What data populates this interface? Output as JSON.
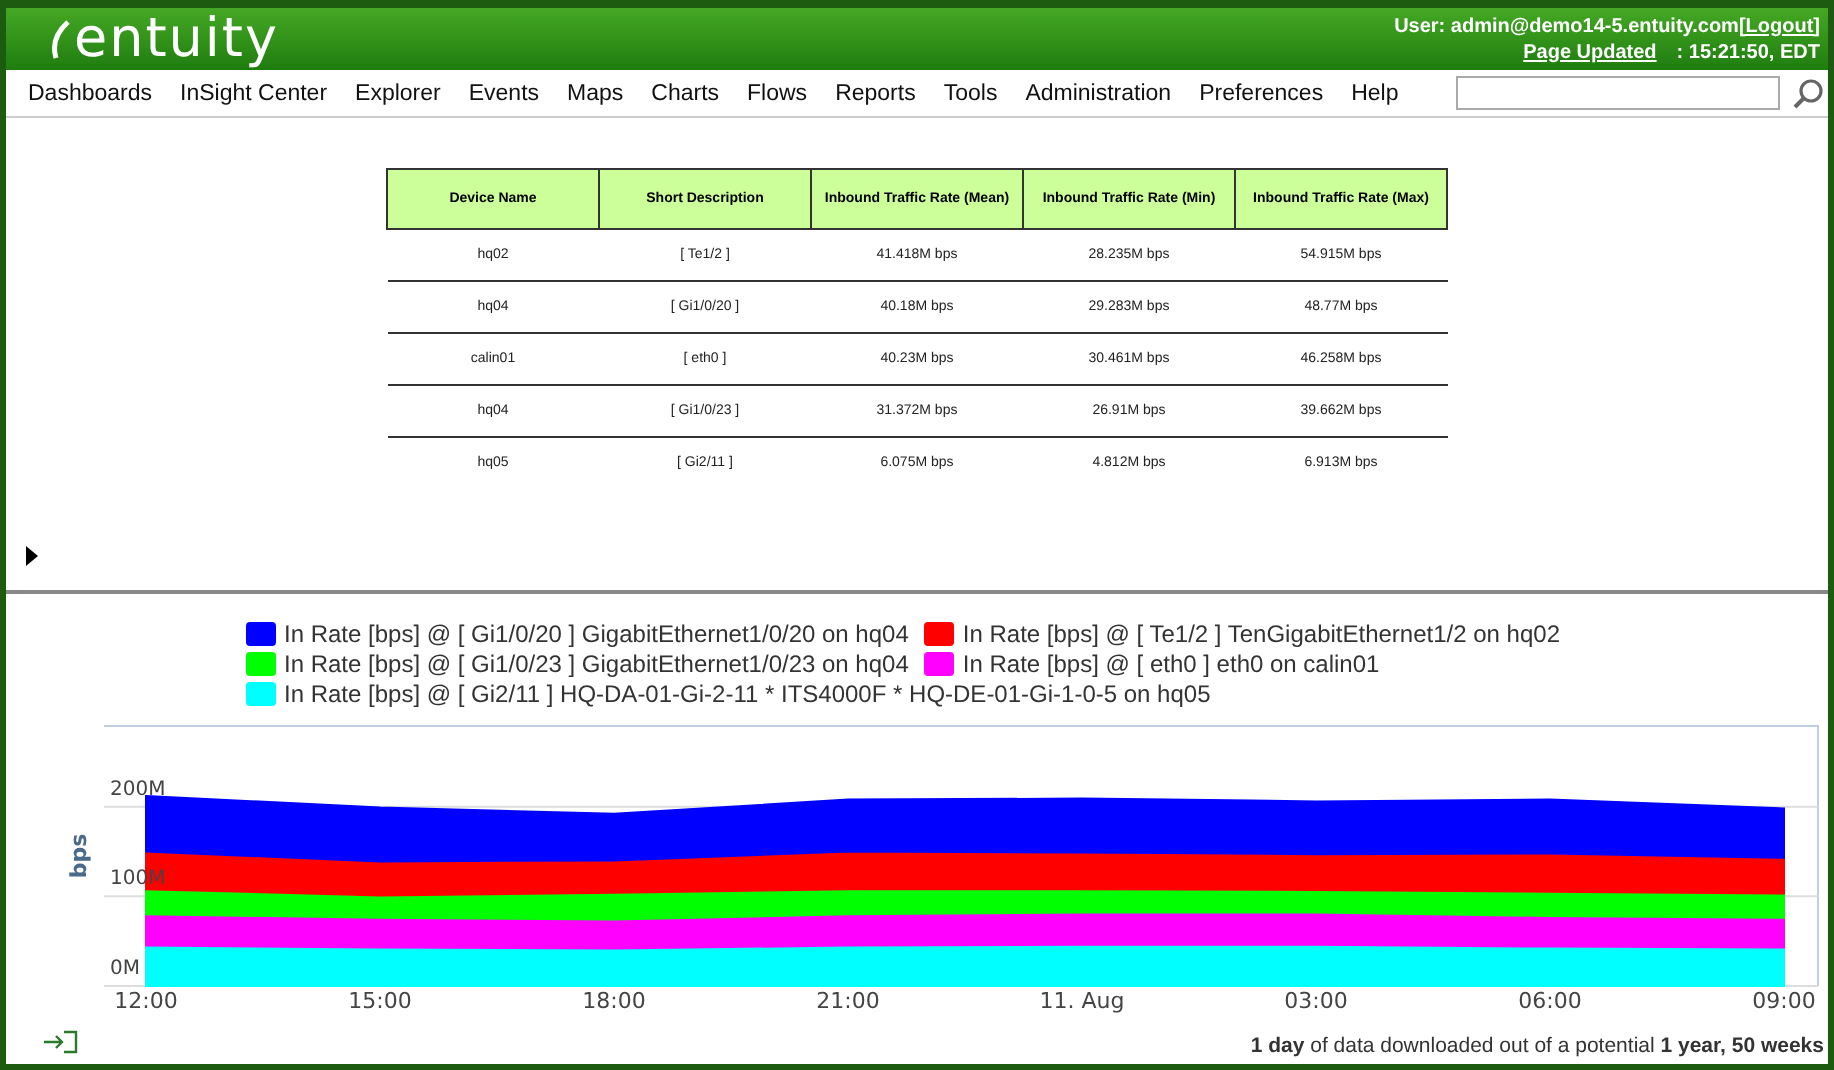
{
  "header": {
    "logo": "entuity",
    "user": "User: admin@demo14-5.entuity.com",
    "logout": "[Logout]",
    "page_updated": "Page Updated",
    "time": ": 15:21:50, EDT"
  },
  "menu": [
    "Dashboards",
    "InSight Center",
    "Explorer",
    "Events",
    "Maps",
    "Charts",
    "Flows",
    "Reports",
    "Tools",
    "Administration",
    "Preferences",
    "Help"
  ],
  "table": {
    "columns": [
      "Device Name",
      "Short Description",
      "Inbound Traffic Rate (Mean)",
      "Inbound Traffic Rate (Min)",
      "Inbound Traffic Rate (Max)"
    ],
    "rows": [
      [
        "hq02",
        "[ Te1/2 ]",
        "41.418M bps",
        "28.235M bps",
        "54.915M bps"
      ],
      [
        "hq04",
        "[ Gi1/0/20 ]",
        "40.18M bps",
        "29.283M bps",
        "48.77M bps"
      ],
      [
        "calin01",
        "[ eth0 ]",
        "40.23M bps",
        "30.461M bps",
        "46.258M bps"
      ],
      [
        "hq04",
        "[ Gi1/0/23 ]",
        "31.372M bps",
        "26.91M bps",
        "39.662M bps"
      ],
      [
        "hq05",
        "[ Gi2/11 ]",
        "6.075M bps",
        "4.812M bps",
        "6.913M bps"
      ]
    ]
  },
  "chart": {
    "chart_data": {
      "type": "area",
      "stacked": true,
      "ylabel": "bps",
      "categories": [
        "12:00",
        "15:00",
        "18:00",
        "21:00",
        "11. Aug",
        "03:00",
        "06:00",
        "09:00"
      ],
      "ylim": [
        0,
        290
      ],
      "yticks": [
        {
          "value": 0,
          "label": "0M"
        },
        {
          "value": 100,
          "label": "100M"
        },
        {
          "value": 200,
          "label": "200M"
        }
      ],
      "series": [
        {
          "name": "In Rate [bps] @ [ Gi1/0/20 ] GigabitEthernet1/0/20 on hq04",
          "color": "#0000ff",
          "values": [
            62,
            60,
            52,
            58,
            60,
            59,
            60,
            55
          ]
        },
        {
          "name": "In Rate [bps] @ [ Te1/2 ] TenGigabitEthernet1/2 on hq02",
          "color": "#ff0000",
          "values": [
            42,
            38,
            36,
            42,
            41,
            40,
            43,
            40
          ]
        },
        {
          "name": "In Rate [bps] @ [ Gi1/0/23 ] GigabitEthernet1/0/23 on hq04",
          "color": "#00ff00",
          "values": [
            28,
            25,
            30,
            28,
            26,
            25,
            27,
            27
          ]
        },
        {
          "name": "In Rate [bps] @ [ eth0 ] eth0 on calin01",
          "color": "#ff00ff",
          "values": [
            35,
            33,
            32,
            35,
            36,
            36,
            34,
            33
          ]
        },
        {
          "name": "In Rate [bps] @ [ Gi2/11 ] HQ-DA-01-Gi-2-11 * ITS4000F * HQ-DE-01-Gi-1-0-5 on hq05",
          "color": "#00ffff",
          "values": [
            45,
            43,
            42,
            45,
            46,
            46,
            44,
            43
          ]
        }
      ]
    },
    "footnote": "**1 day** of data downloaded out of a potential **1 year, 50 weeks**"
  }
}
